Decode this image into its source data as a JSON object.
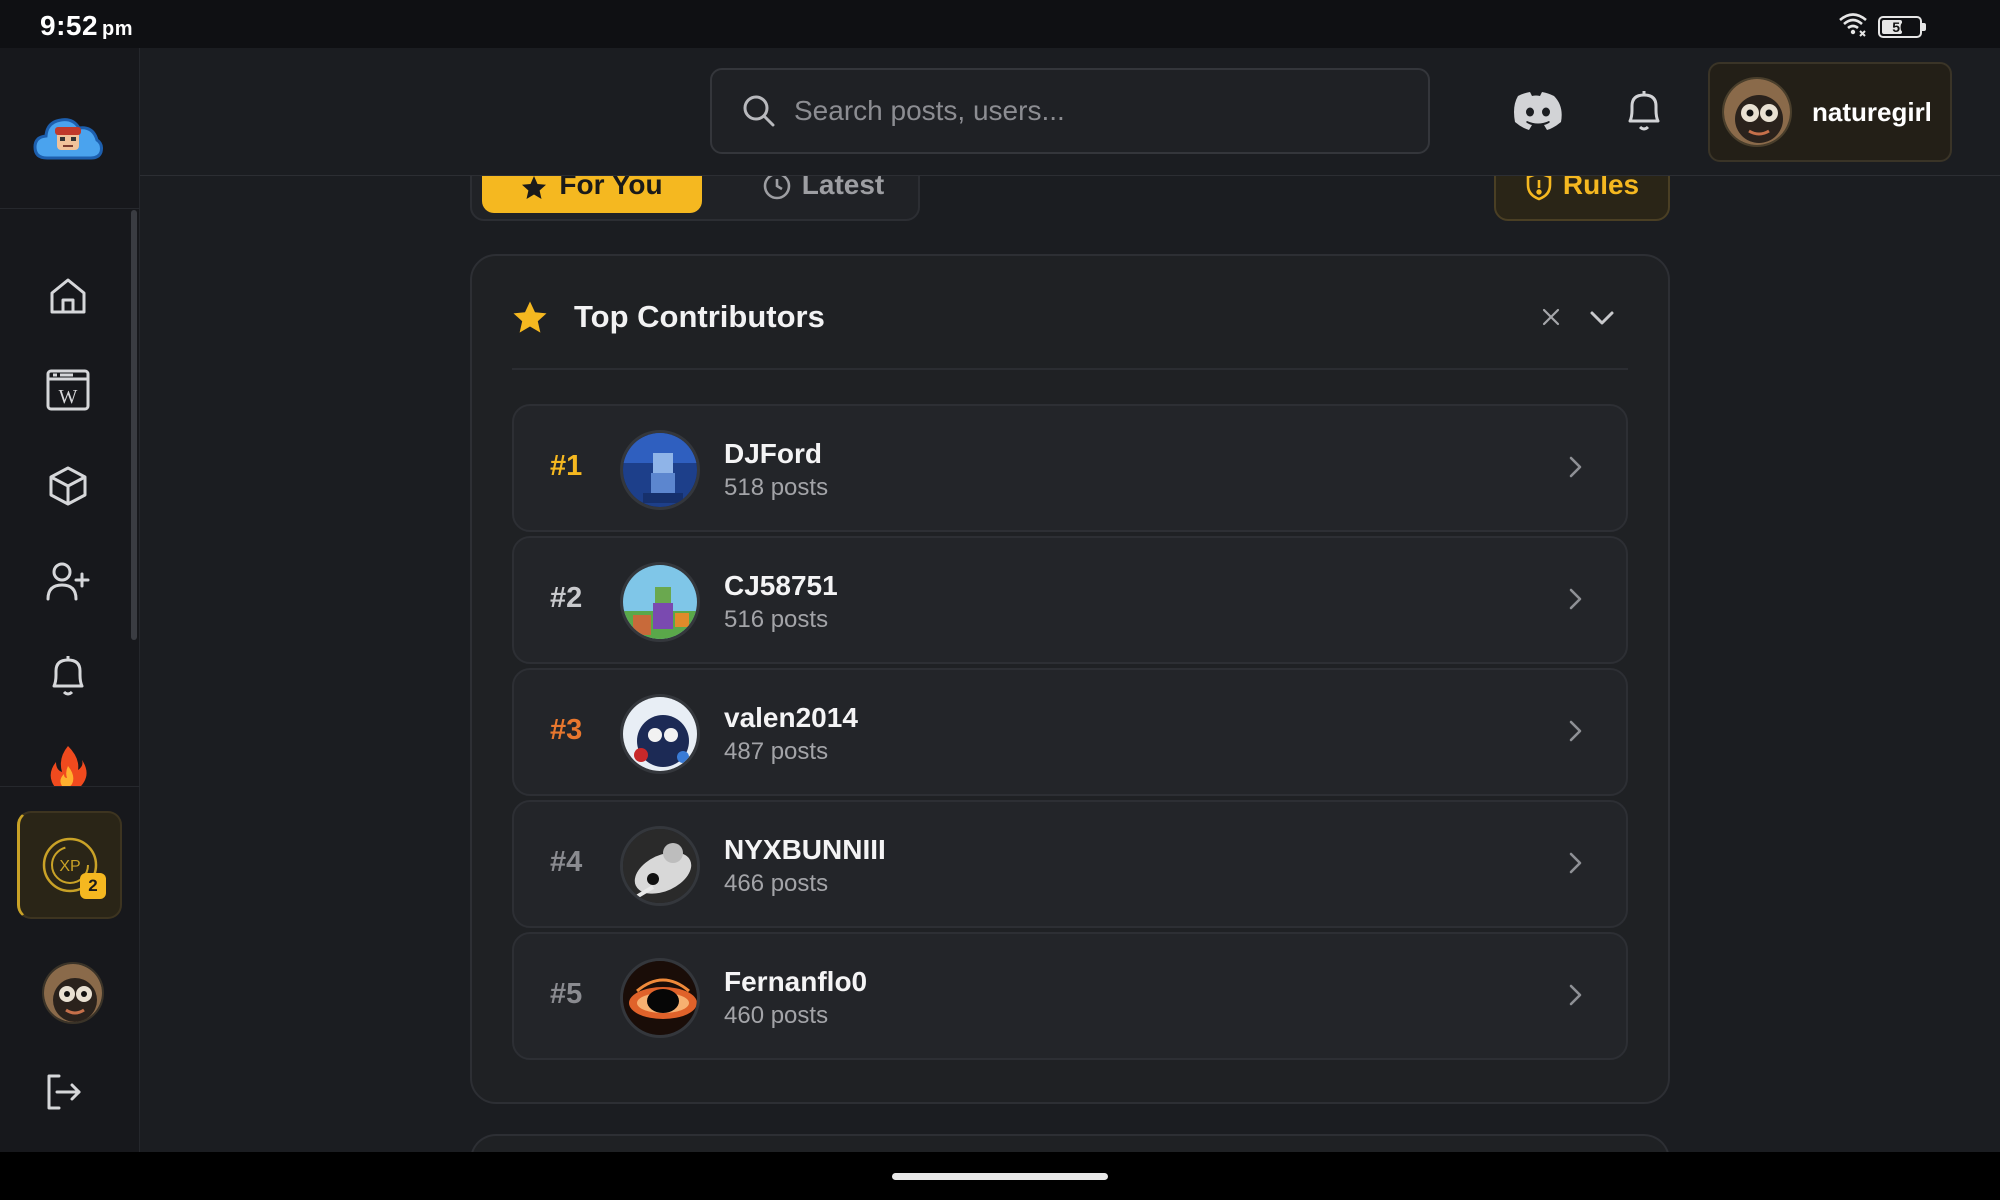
{
  "status_bar": {
    "time": "9:52",
    "ampm": "pm",
    "battery_level": "50"
  },
  "header": {
    "search_placeholder": "Search posts, users...",
    "username": "naturegirl"
  },
  "sidebar": {
    "xp_label": "XP",
    "xp_badge": "2"
  },
  "tabs": {
    "for_you": "For You",
    "latest": "Latest",
    "rules": "Rules"
  },
  "top_contributors": {
    "title": "Top Contributors",
    "entries": [
      {
        "rank": "#1",
        "name": "DJFord",
        "posts": "518 posts",
        "rank_color": "#f5b820"
      },
      {
        "rank": "#2",
        "name": "CJ58751",
        "posts": "516 posts",
        "rank_color": "#c9cacd"
      },
      {
        "rank": "#3",
        "name": "valen2014",
        "posts": "487 posts",
        "rank_color": "#e8772e"
      },
      {
        "rank": "#4",
        "name": "NYXBUNNIII",
        "posts": "466 posts",
        "rank_color": "#8a8b90"
      },
      {
        "rank": "#5",
        "name": "Fernanflo0",
        "posts": "460 posts",
        "rank_color": "#8a8b90"
      }
    ]
  },
  "colors": {
    "accent": "#f5b820",
    "background": "#1b1d21",
    "card": "#1f2124"
  }
}
